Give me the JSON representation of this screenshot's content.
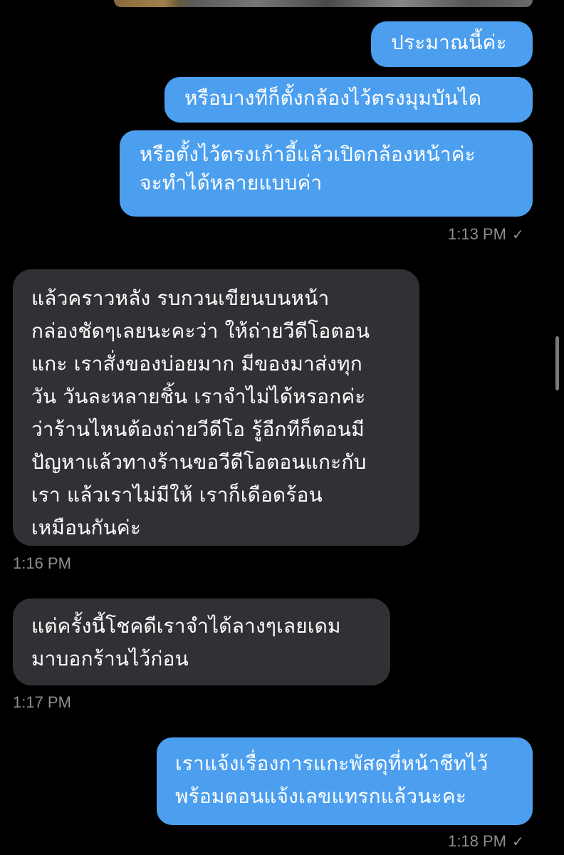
{
  "messages": [
    {
      "direction": "outgoing",
      "lines": [
        "ประมาณนี้ค่ะ"
      ]
    },
    {
      "direction": "outgoing",
      "lines": [
        "หรือบางทีก็ตั้งกล้องไว้ตรงมุมบันได"
      ]
    },
    {
      "direction": "outgoing",
      "lines": [
        "หรือตั้งไว้ตรงเก้าอี้แล้วเปิดกล้องหน้าค่ะ",
        "จะทำได้หลายแบบค่า"
      ]
    },
    {
      "direction": "incoming",
      "lines": [
        "แล้วคราวหลัง รบกวนเขียนบนหน้า",
        "กล่องชัดๆเลยนะคะว่า ให้ถ่ายวีดีโอตอน",
        "แกะ เราสั่งของบ่อยมาก มีของมาส่งทุก",
        "วัน วันละหลายชิ้น เราจำไม่ได้หรอกค่ะ",
        "ว่าร้านไหนต้องถ่ายวีดีโอ รู้อีกทีก็ตอนมี",
        "ปัญหาแล้วทางร้านขอวีดีโอตอนแกะกับ",
        "เรา แล้วเราไม่มีให้ เราก็เดือดร้อน",
        "เหมือนกันค่ะ"
      ]
    },
    {
      "direction": "incoming",
      "lines": [
        "แต่ครั้งนี้โชคดีเราจำได้ลางๆเลยเดม",
        "มาบอกร้านไว้ก่อน"
      ]
    },
    {
      "direction": "outgoing",
      "lines": [
        "เราแจ้งเรื่องการแกะพัสดุที่หน้าชีทไว้",
        "พร้อมตอนแจ้งเลขแทรกแล้วนะคะ"
      ]
    }
  ],
  "timestamps": {
    "t1": "1:13 PM",
    "t2": "1:16 PM",
    "t3": "1:17 PM",
    "t4": "1:18 PM"
  },
  "status_icon": "check-icon",
  "colors": {
    "outgoing_bubble": "#4c9fee",
    "incoming_bubble": "#2f3134",
    "background": "#000000",
    "timestamp": "#8e8e93"
  }
}
